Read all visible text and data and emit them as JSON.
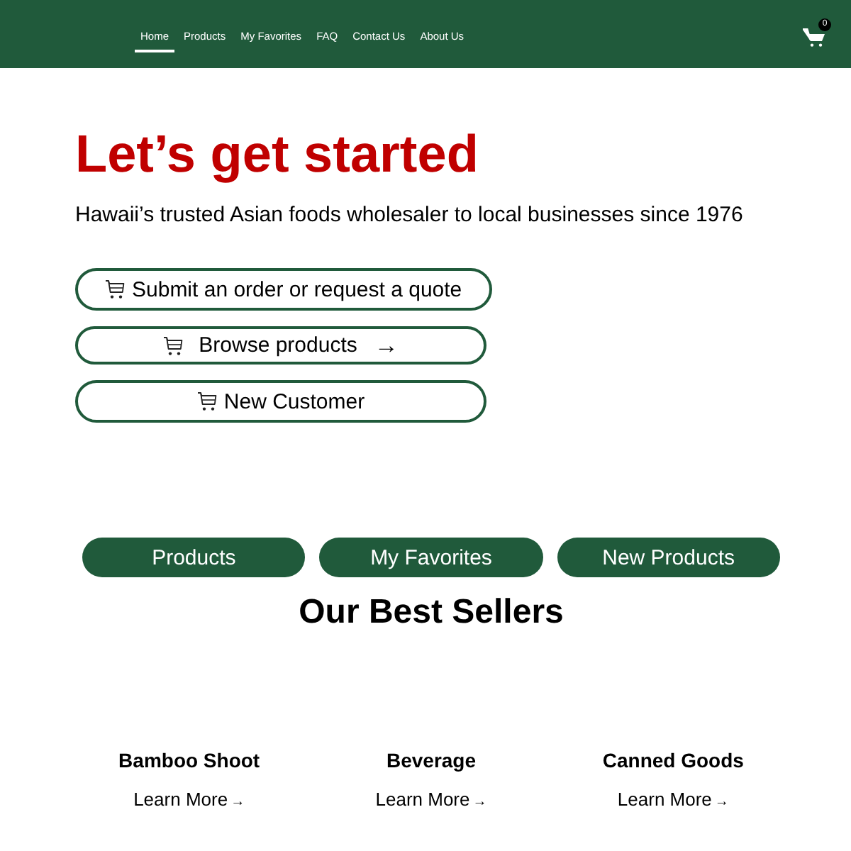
{
  "header": {
    "nav": [
      {
        "label": "Home",
        "selected": true
      },
      {
        "label": "Products",
        "selected": false
      },
      {
        "label": "My Favorites",
        "selected": false
      },
      {
        "label": "FAQ",
        "selected": false
      },
      {
        "label": "Contact Us",
        "selected": false
      },
      {
        "label": "About Us",
        "selected": false
      }
    ],
    "cart_count": "0"
  },
  "hero": {
    "title": "Let’s get started",
    "subtitle": "Hawaii’s trusted Asian foods wholesaler to local businesses since 1976",
    "buttons": [
      {
        "kind": "auto",
        "label": "Submit an order or request a quote"
      },
      {
        "kind": "wide",
        "label": "Browse products",
        "arrow": "→"
      },
      {
        "kind": "wide",
        "label": "New Customer"
      }
    ]
  },
  "tabs": [
    {
      "label": "Products"
    },
    {
      "label": "My Favorites"
    },
    {
      "label": "New Products"
    }
  ],
  "best_sellers": {
    "title": "Our Best Sellers",
    "items": [
      {
        "name": "Bamboo Shoot",
        "link": "Learn More",
        "arrow": "→"
      },
      {
        "name": "Beverage",
        "link": "Learn More",
        "arrow": "→"
      },
      {
        "name": "Canned Goods",
        "link": "Learn More",
        "arrow": "→"
      }
    ]
  }
}
